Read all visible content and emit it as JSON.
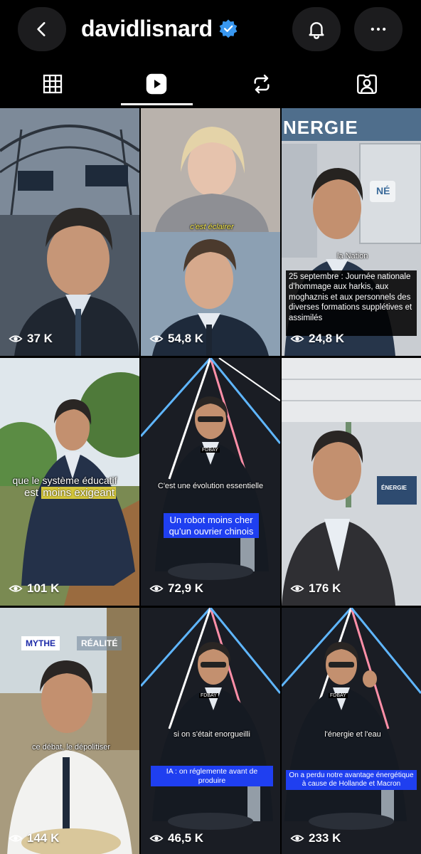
{
  "header": {
    "username": "davidlisnard",
    "icons": {
      "back": "chevron-left-icon",
      "verified": "verified-badge-icon",
      "notifications": "bell-icon",
      "more": "ellipsis-icon"
    },
    "verified_color": "#3897f0"
  },
  "tabs": [
    {
      "icon": "grid-icon",
      "active": false
    },
    {
      "icon": "reels-icon",
      "active": true
    },
    {
      "icon": "repost-icon",
      "active": false
    },
    {
      "icon": "tagged-icon",
      "active": false
    }
  ],
  "reels": [
    {
      "views": "37 K"
    },
    {
      "views": "54,8 K",
      "caption": "c'est éclairer"
    },
    {
      "views": "24,8 K",
      "brand": "la Nation",
      "sign": "NERGIE",
      "badge": "NÉ",
      "caption": "25 septembre : Journée nationale d'hommage aux harkis, aux moghaznis et aux personnels des diverses formations supplétives et assimilés"
    },
    {
      "views": "101 K",
      "caption_line1": "que le système éducatif",
      "caption_line2a": "est ",
      "caption_line2b": "moins exigeant"
    },
    {
      "views": "72,9 K",
      "caption": "C'est une évolution essentielle",
      "caption_box": "Un robot moins cher qu'un ouvrier chinois",
      "mic_label": "FDBAY"
    },
    {
      "views": "176 K",
      "sign": "ÉNERGIE"
    },
    {
      "views": "144 K",
      "tag_left": "MYTHE",
      "tag_right": "RÉALITÉ",
      "caption": "ce débat, le dépolitiser"
    },
    {
      "views": "46,5 K",
      "caption": "si on s'était enorgueilli",
      "caption_box": "IA : on réglemente avant de produire",
      "mic_label": "FDBAY"
    },
    {
      "views": "233 K",
      "caption": "l'énergie et l'eau",
      "caption_box": "On a perdu notre avantage énergétique à cause de Hollande et Macron",
      "mic_label": "FDBAY"
    }
  ]
}
